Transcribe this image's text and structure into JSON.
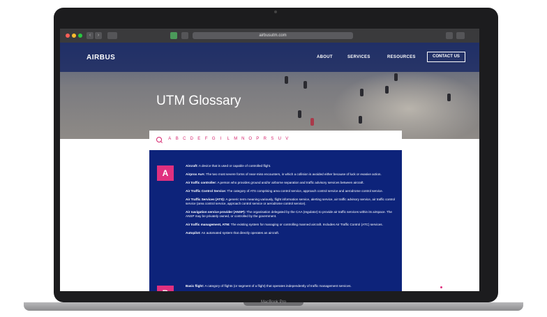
{
  "device": {
    "label": "MacBook Pro"
  },
  "browser": {
    "url": "airbusutm.com"
  },
  "site": {
    "logo": "AIRBUS",
    "nav": {
      "about": "ABOUT",
      "services": "SERVICES",
      "resources": "RESOURCES",
      "contact": "CONTACT US"
    },
    "hero_title": "UTM Glossary"
  },
  "glossary": {
    "letters": [
      "A",
      "B",
      "C",
      "D",
      "E",
      "F",
      "G",
      "I",
      "L",
      "M",
      "N",
      "O",
      "P",
      "R",
      "S",
      "U",
      "V"
    ],
    "section_a": {
      "letter": "A",
      "entries": [
        {
          "term": "Aircraft:",
          "def": "A device that is used or capable of controlled flight."
        },
        {
          "term": "Airprox AvA:",
          "def": "The two most severe forms of near-miss encounters, in which a collision is avoided either because of luck or evasive action."
        },
        {
          "term": "Air traffic controller:",
          "def": "A person who provides ground and/or airborne separation and traffic advisory services between aircraft."
        },
        {
          "term": "Air Traffic Control Service:",
          "def": "The category of ATS comprising area control service, approach control service and aerodrome control service."
        },
        {
          "term": "Air Traffic Services (ATS):",
          "def": "A generic term meaning variously, flight information service, alerting service, air traffic advisory service, air traffic control service (area control service, approach control service or aerodrome control service)."
        },
        {
          "term": "Air navigation service provider (ANSP):",
          "def": "The organisation delegated by the CAA (regulator) to provide air traffic services within its airspace. The ANSP may be privately owned, or controlled by the government."
        },
        {
          "term": "Air traffic management, ATM:",
          "def": "The existing system for managing or controlling manned aircraft. Includes Air Traffic Control (ATC) services."
        },
        {
          "term": "Autopilot:",
          "def": "An automated system that directly operates an aircraft."
        }
      ]
    },
    "section_b": {
      "letter": "B",
      "entries": [
        {
          "term": "Basic flight:",
          "def": "A category of flights (or segment of a flight) that operates independently of traffic management services."
        }
      ]
    }
  }
}
